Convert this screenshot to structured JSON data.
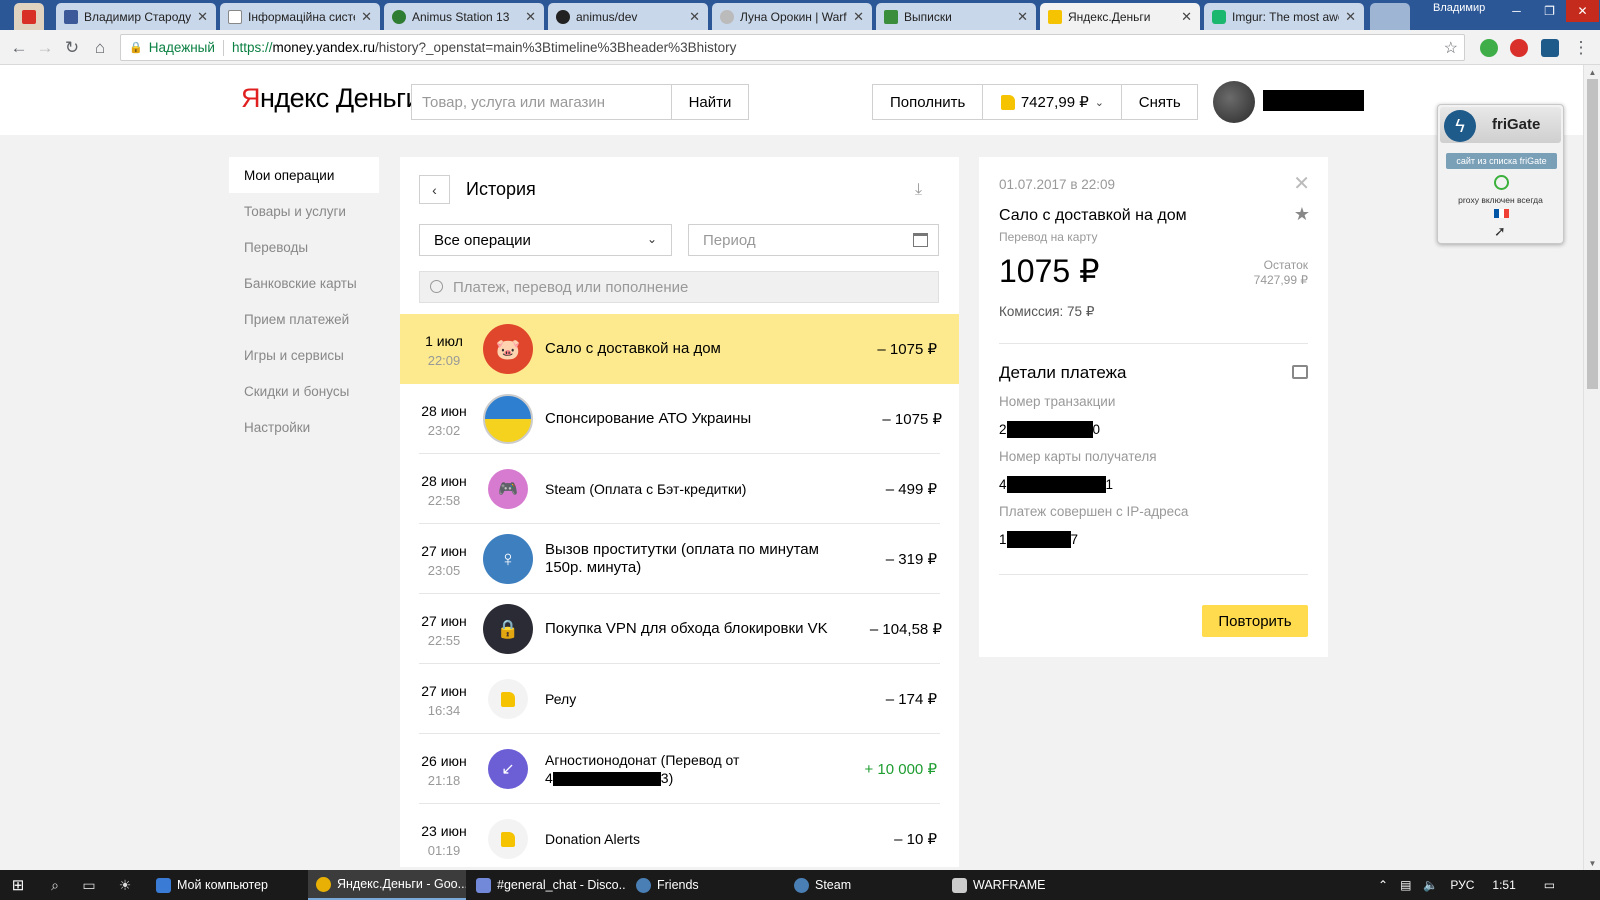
{
  "browser": {
    "tabs": [
      {
        "label": "Владимир Стародуб",
        "fav_color": "#3b5998"
      },
      {
        "label": "Інформаційна система",
        "fav_color": "#ffffff"
      },
      {
        "label": "Animus Station 13",
        "fav_color": "#2e7d32"
      },
      {
        "label": "animus/dev",
        "fav_color": "#222222"
      },
      {
        "label": "Луна Орокин | Warframe",
        "fav_color": "#bbbbbb"
      },
      {
        "label": "Выписки",
        "fav_color": "#3a8d3a"
      },
      {
        "label": "Яндекс.Деньги",
        "fav_color": "#f5c300"
      },
      {
        "label": "Imgur: The most awesome",
        "fav_color": "#1bb76e"
      }
    ],
    "user": "Владимир",
    "secure_label": "Надежный",
    "url_scheme": "https://",
    "url_host": "money.yandex.ru",
    "url_path": "/history?_openstat=main%3Btimeline%3Bheader%3Bhistory"
  },
  "header": {
    "logo_y": "Я",
    "logo_rest": "ндекс",
    "logo_money": "Деньги",
    "search_placeholder": "Товар, услуга или магазин",
    "find_label": "Найти",
    "topup_label": "Пополнить",
    "balance": "7427,99 ₽",
    "withdraw_label": "Снять"
  },
  "leftmenu": {
    "items": [
      {
        "label": "Мои операции",
        "active": true
      },
      {
        "label": "Товары и услуги"
      },
      {
        "label": "Переводы"
      },
      {
        "label": "Банковские карты"
      },
      {
        "label": "Прием платежей"
      },
      {
        "label": "Игры и сервисы"
      },
      {
        "label": "Скидки и бонусы"
      },
      {
        "label": "Настройки"
      }
    ]
  },
  "history": {
    "title": "История",
    "filter_value": "Все операции",
    "period_placeholder": "Период",
    "search_placeholder": "Платеж, перевод или пополнение",
    "operations": [
      {
        "day": "1 июл",
        "time": "22:09",
        "name": "Сало с доставкой на дом",
        "amount": "– 1075 ₽",
        "icon": "pig-icon",
        "icon_color": "#e0462b"
      },
      {
        "day": "28 июн",
        "time": "23:02",
        "name": "Спонсирование АТО Украины",
        "amount": "– 1075 ₽",
        "icon": "ukraine-flag-icon",
        "icon_color": "#2f7fd0"
      },
      {
        "day": "28 июн",
        "time": "22:58",
        "name": "Steam (Оплата с Бэт-кредитки)",
        "amount": "– 499 ₽",
        "icon": "gamepad-icon",
        "icon_color": "#d77bd0"
      },
      {
        "day": "27 июн",
        "time": "23:05",
        "name": "Вызов проститутки (оплата по минутам 150р. минута)",
        "amount": "– 319 ₽",
        "icon": "venus-icon",
        "icon_color": "#3e7fbf"
      },
      {
        "day": "27 июн",
        "time": "22:55",
        "name": "Покупка VPN для обхода блокировки VK",
        "amount": "– 104,58 ₽",
        "icon": "vpn-lock-icon",
        "icon_color": "#2b2b35"
      },
      {
        "day": "27 июн",
        "time": "16:34",
        "name": "Релу",
        "amount": "– 174 ₽",
        "icon": "wallet-icon",
        "icon_color": "#f3f3f3"
      },
      {
        "day": "26 июн",
        "time": "21:18",
        "name_line1": "Агностионодонат (Перевод от",
        "name_prefix": "4",
        "name_suffix": "3)",
        "amount": "+ 10 000 ₽",
        "icon": "incoming-transfer-icon",
        "icon_color": "#6c5fd6"
      },
      {
        "day": "23 июн",
        "time": "01:19",
        "name": "Donation Alerts",
        "amount": "– 10 ₽",
        "icon": "wallet-icon",
        "icon_color": "#f3f3f3"
      }
    ]
  },
  "detail": {
    "datetime": "01.07.2017 в 22:09",
    "title": "Сало с доставкой на дом",
    "subtitle": "Перевод на карту",
    "amount": "1075 ₽",
    "balance_label": "Остаток",
    "balance_value": "7427,99 ₽",
    "commission": "Комиссия: 75 ₽",
    "section_title": "Детали платежа",
    "txn_label": "Номер транзакции",
    "txn_prefix": "2",
    "txn_suffix": "0",
    "card_label": "Номер карты получателя",
    "card_prefix": "4",
    "card_suffix": "1",
    "ip_label": "Платеж совершен с IP-адреса",
    "ip_prefix": "1",
    "ip_suffix": "7",
    "repeat_label": "Повторить"
  },
  "frigate": {
    "name": "friGate",
    "badge": "сайт из списка friGate",
    "proxy": "proxy включен всегда"
  },
  "taskbar": {
    "apps": [
      {
        "label": "Мой компьютер",
        "color": "#3a7bd5"
      },
      {
        "label": "Яндекс.Деньги - Goo...",
        "color": "#e8b004",
        "active": true
      },
      {
        "label": "#general_chat - Disco...",
        "color": "#7289da"
      },
      {
        "label": "Friends",
        "color": "#1b2838"
      },
      {
        "label": "Steam",
        "color": "#1b2838"
      },
      {
        "label": "WARFRAME",
        "color": "#cccccc"
      }
    ],
    "lang": "РУС",
    "time": "1:51"
  },
  "colors": {
    "accent_yellow": "#ffdb4d",
    "highlight_row": "#fdea8e",
    "income_green": "#1e9d30",
    "yandex_red": "#e02020"
  }
}
